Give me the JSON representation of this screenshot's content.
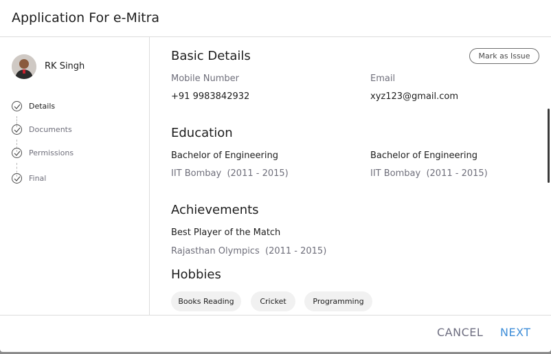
{
  "header": {
    "title": "Application For e-Mitra"
  },
  "user": {
    "name": "RK Singh"
  },
  "steps": [
    {
      "label": "Details"
    },
    {
      "label": "Documents"
    },
    {
      "label": "Permissions"
    },
    {
      "label": "Final"
    }
  ],
  "basic_details": {
    "heading": "Basic Details",
    "mark_issue_label": "Mark as Issue",
    "mobile_label": "Mobile Number",
    "mobile_value": "+91 9983842932",
    "email_label": "Email",
    "email_value": "xyz123@gmail.com"
  },
  "education": {
    "heading": "Education",
    "items": [
      {
        "degree": "Bachelor of Engineering",
        "institute": "IIT Bombay",
        "years": "(2011 - 2015)"
      },
      {
        "degree": "Bachelor of Engineering",
        "institute": "IIT Bombay",
        "years": "(2011 - 2015)"
      }
    ]
  },
  "achievements": {
    "heading": "Achievements",
    "items": [
      {
        "title": "Best Player of the Match",
        "event": "Rajasthan Olympics",
        "years": "(2011 - 2015)"
      }
    ]
  },
  "hobbies": {
    "heading": "Hobbies",
    "items": [
      "Books Reading",
      "Cricket",
      "Programming"
    ]
  },
  "footer": {
    "cancel_label": "CANCEL",
    "next_label": "NEXT"
  },
  "colors": {
    "accent": "#3f8ed8",
    "muted": "#6e6e7a",
    "text": "#1c1c1c",
    "divider": "#dcdcdc"
  }
}
